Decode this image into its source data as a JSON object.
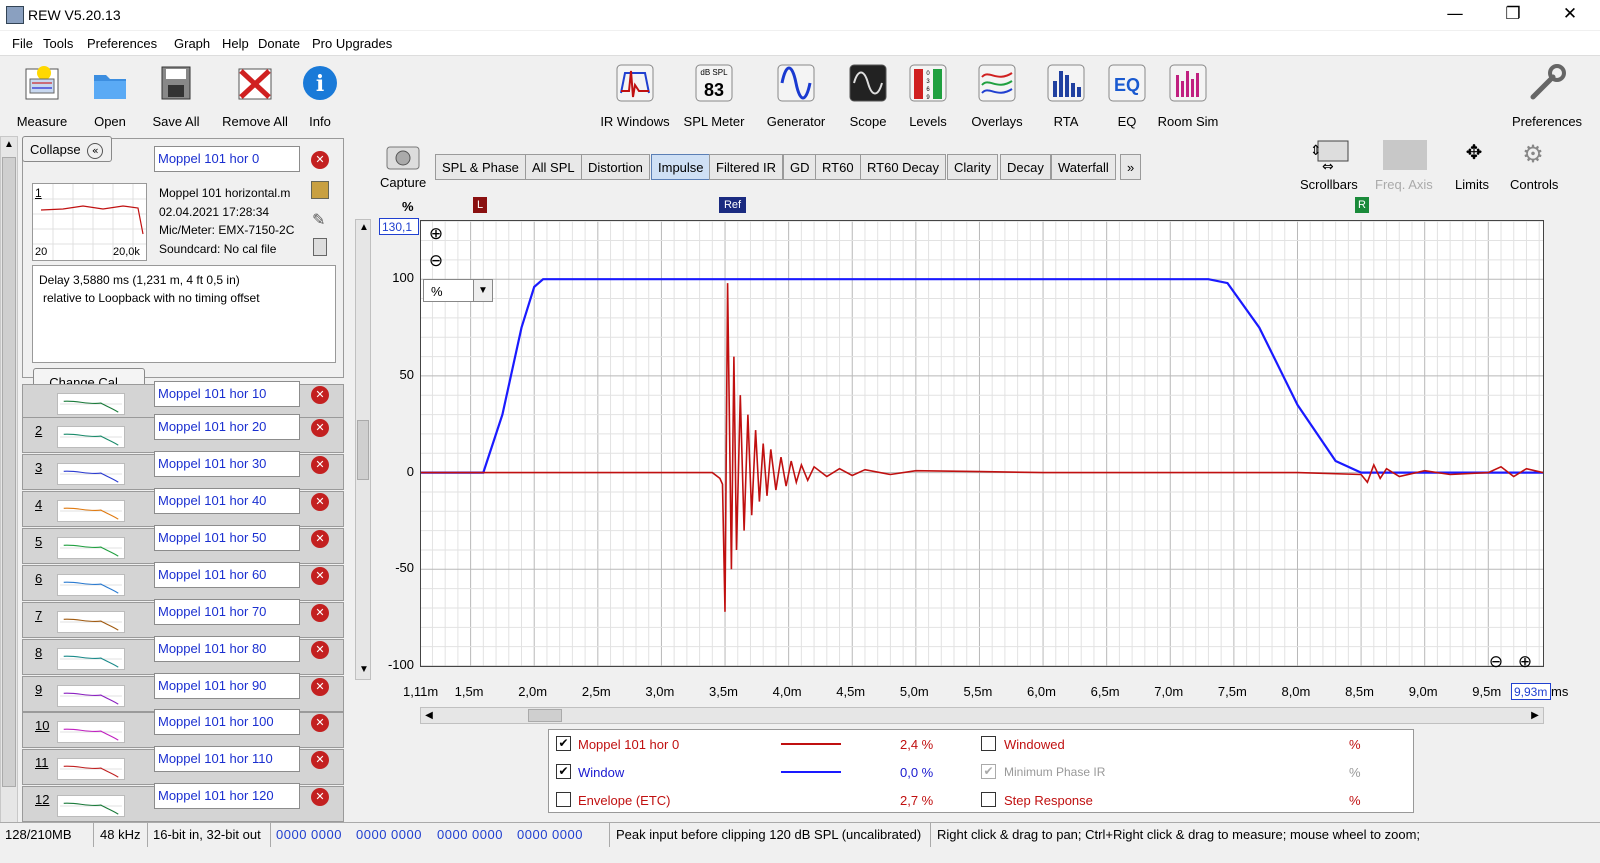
{
  "app": {
    "title": "REW V5.20.13"
  },
  "window_controls": {
    "minimize": "—",
    "maximize": "❐",
    "close": "✕"
  },
  "menu": [
    "File",
    "Tools",
    "Preferences",
    "Graph",
    "Help",
    "Donate",
    "Pro Upgrades"
  ],
  "toolbar_left": [
    "Measure",
    "Open",
    "Save All",
    "Remove All",
    "Info"
  ],
  "toolbar_center": [
    "IR Windows",
    "SPL Meter",
    "Generator",
    "Scope",
    "Levels",
    "Overlays",
    "RTA",
    "EQ",
    "Room Sim"
  ],
  "toolbar_right": {
    "preferences": "Preferences"
  },
  "spl_icon": {
    "unit": "dB SPL",
    "value": "83"
  },
  "eq_icon_text": "EQ",
  "levels_icon_text": [
    "0",
    "3",
    "6",
    "9"
  ],
  "left_panel": {
    "collapse_label": "Collapse",
    "collapse_icon": "«",
    "main_measurement": {
      "name": "Moppel 101 hor 0",
      "index": "1",
      "thumb_left": "20",
      "thumb_right": "20,0k",
      "info": [
        "Moppel 101 horizontal.m",
        "02.04.2021 17:28:34",
        "Mic/Meter: EMX-7150-2C",
        "Soundcard: No cal file"
      ],
      "notes_line1": "Delay 3,5880 ms (1,231 m, 4 ft 0,5 in)",
      "notes_line2": "relative to Loopback with no timing offset"
    },
    "change_cal_label": "Change Cal...",
    "measurements": [
      {
        "num": "",
        "name": "Moppel 101 hor 10",
        "color": "#1a7a3a"
      },
      {
        "num": "2",
        "name": "Moppel 101 hor 20",
        "color": "#1a8a6a"
      },
      {
        "num": "3",
        "name": "Moppel 101 hor 30",
        "color": "#2a3ad0"
      },
      {
        "num": "4",
        "name": "Moppel 101 hor 40",
        "color": "#e07a10"
      },
      {
        "num": "5",
        "name": "Moppel 101 hor 50",
        "color": "#20a040"
      },
      {
        "num": "6",
        "name": "Moppel 101 hor 60",
        "color": "#2a7ad0"
      },
      {
        "num": "7",
        "name": "Moppel 101 hor 70",
        "color": "#a05a10"
      },
      {
        "num": "8",
        "name": "Moppel 101 hor 80",
        "color": "#1a8a8a"
      },
      {
        "num": "9",
        "name": "Moppel 101 hor 90",
        "color": "#8a20c0"
      },
      {
        "num": "10",
        "name": "Moppel 101 hor 100",
        "color": "#c020c0"
      },
      {
        "num": "11",
        "name": "Moppel 101 hor 110",
        "color": "#c02020"
      },
      {
        "num": "12",
        "name": "Moppel 101 hor 120",
        "color": "#1a7a3a"
      }
    ]
  },
  "graph": {
    "capture_label": "Capture",
    "tabs": [
      "SPL & Phase",
      "All SPL",
      "Distortion",
      "Impulse",
      "Filtered IR",
      "GD",
      "RT60",
      "RT60 Decay",
      "Clarity",
      "Decay",
      "Waterfall",
      "»"
    ],
    "selected_tab": "Impulse",
    "right_controls": [
      "Scrollbars",
      "Freq. Axis",
      "Limits",
      "Controls"
    ],
    "y_unit": "%",
    "y_max_box": "130,1",
    "unit_select": "%",
    "x_unit": "ms",
    "x_min_label": "1,11m",
    "x_max_box": "9,93m",
    "markers": {
      "left": "L",
      "ref": "Ref",
      "right": "R"
    },
    "zoom_in": "⊕",
    "zoom_out": "⊖"
  },
  "chart_data": {
    "type": "line",
    "title": "",
    "xlabel": "ms",
    "ylabel": "%",
    "xlim": [
      1.11,
      9.93
    ],
    "ylim": [
      -100,
      130.1
    ],
    "x_ticks": [
      "1,5m",
      "2,0m",
      "2,5m",
      "3,0m",
      "3,5m",
      "4,0m",
      "4,5m",
      "5,0m",
      "5,5m",
      "6,0m",
      "6,5m",
      "7,0m",
      "7,5m",
      "8,0m",
      "8,5m",
      "9,0m",
      "9,5m"
    ],
    "y_ticks": [
      "100",
      "50",
      "0",
      "-50",
      "-100"
    ],
    "series": [
      {
        "name": "Window",
        "color": "#1a1aff",
        "x": [
          1.11,
          1.6,
          1.75,
          1.9,
          2.0,
          2.07,
          7.3,
          7.45,
          7.7,
          8.0,
          8.3,
          8.5,
          9.93
        ],
        "y": [
          0,
          0,
          30,
          75,
          96,
          100,
          100,
          98,
          75,
          35,
          6,
          0,
          0
        ]
      },
      {
        "name": "Moppel 101 hor 0",
        "color": "#c01010",
        "x": [
          1.11,
          3.0,
          3.4,
          3.46,
          3.48,
          3.5,
          3.52,
          3.55,
          3.57,
          3.59,
          3.62,
          3.65,
          3.68,
          3.71,
          3.74,
          3.77,
          3.8,
          3.83,
          3.86,
          3.9,
          3.94,
          3.98,
          4.02,
          4.06,
          4.1,
          4.15,
          4.2,
          4.3,
          4.4,
          4.5,
          4.6,
          4.8,
          5.0,
          5.5,
          6.0,
          7.0,
          8.0,
          8.5,
          8.55,
          8.6,
          8.65,
          8.7,
          8.8,
          9.0,
          9.2,
          9.5,
          9.6,
          9.7,
          9.8,
          9.93
        ],
        "y": [
          0,
          0,
          0,
          -3,
          -6,
          -72,
          98,
          -50,
          60,
          -40,
          40,
          -30,
          30,
          -22,
          22,
          -15,
          15,
          -12,
          12,
          -9,
          8,
          -7,
          6,
          -5,
          4,
          -4,
          3,
          -2,
          2,
          -1.5,
          1.5,
          -1,
          1,
          0.5,
          0,
          0,
          0,
          -1,
          -5,
          4,
          -3,
          2,
          -2,
          1,
          -1,
          0,
          3,
          -2,
          2,
          0
        ]
      }
    ]
  },
  "legend": {
    "rows": [
      {
        "checked": true,
        "name": "Moppel 101 hor 0",
        "color": "#c01010",
        "value": "2,4 %"
      },
      {
        "checked": true,
        "name": "Window",
        "color": "#1a1aff",
        "value": "0,0 %"
      },
      {
        "checked": false,
        "name": "Envelope (ETC)",
        "color": "",
        "value": "2,7 %"
      }
    ],
    "right_rows": [
      {
        "checked": false,
        "name": "Windowed",
        "value": "%",
        "disabled": false
      },
      {
        "checked": true,
        "name": "Minimum Phase IR",
        "value": "%",
        "disabled": true
      },
      {
        "checked": false,
        "name": "Step Response",
        "value": "%",
        "disabled": false
      }
    ]
  },
  "status": {
    "memory": "128/210MB",
    "rate": "48 kHz",
    "bits": "16-bit in, 32-bit out",
    "codes": [
      "0000 0000",
      "0000 0000",
      "0000 0000",
      "0000 0000"
    ],
    "peak": "Peak input before clipping 120 dB SPL (uncalibrated)",
    "hint": "Right click & drag to pan; Ctrl+Right click & drag to measure; mouse wheel to zoom;"
  }
}
